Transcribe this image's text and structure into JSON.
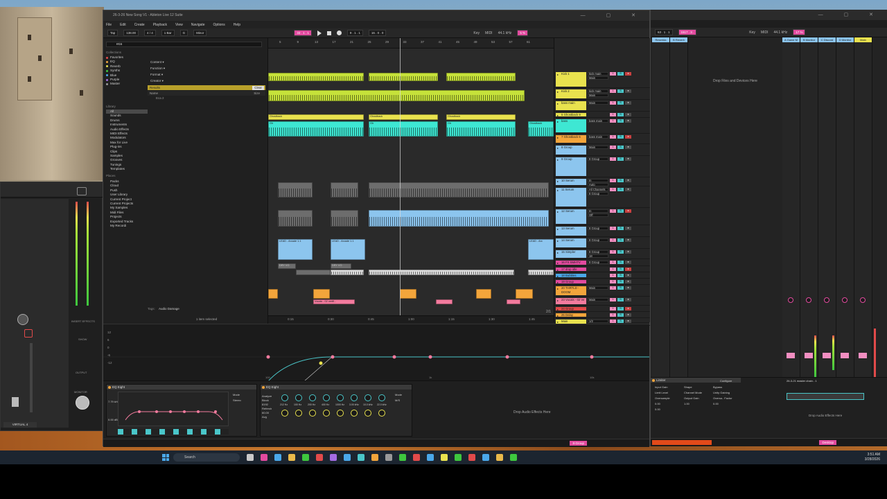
{
  "window": {
    "title": "26-3-26 New Song V1 - Ableton Live 12 Suite",
    "menu": [
      "File",
      "Edit",
      "Create",
      "Playback",
      "View",
      "Navigate",
      "Options",
      "Help"
    ]
  },
  "transport": {
    "tap": "Tap",
    "tempo": "138.00",
    "time_sig": "4 / 4",
    "quantize": "1 Bar",
    "key": "G",
    "scale": "Minor",
    "position": "33 . 1 . 1",
    "loop_start": "9 . 1 . 1",
    "loop_len": "16 . 0 . 0",
    "key_label": "Key",
    "midi_label": "MIDI",
    "sample_rate": "44.1 kHz",
    "cpu": "5 %"
  },
  "browser": {
    "search_value": "eca",
    "collections_title": "Collections",
    "collections": [
      {
        "label": "Favorites",
        "color": "#e24a4a"
      },
      {
        "label": "EQ",
        "color": "#f3a53b"
      },
      {
        "label": "Reverb",
        "color": "#e9e24e"
      },
      {
        "label": "Synths",
        "color": "#3ec73e"
      },
      {
        "label": "Blue",
        "color": "#4aa8ea"
      },
      {
        "label": "Purple",
        "color": "#a36be2"
      },
      {
        "label": "Master",
        "color": "#999999"
      }
    ],
    "library_title": "Library",
    "library": [
      "All",
      "Sounds",
      "Drums",
      "Instruments",
      "Audio Effects",
      "MIDI Effects",
      "Modulators",
      "Max for Live",
      "Plug-ins",
      "Clips",
      "Samples",
      "Grooves",
      "Tunings",
      "Templates"
    ],
    "places_title": "Places",
    "places": [
      "Packs",
      "Cloud",
      "Push",
      "User Library",
      "Current Project",
      "Current Projects",
      "My Samples",
      "Midi Files",
      "Projects",
      "Exported Tracks",
      "My Recordi"
    ],
    "filters": [
      "Content ▾",
      "Function ▾",
      "Format ▾",
      "Creator ▾"
    ],
    "results_label": "Results",
    "clear_label": "Clear",
    "name_col": "Name",
    "size_col": "Size",
    "result_item": "Eca 2",
    "tags_label": "Tags:",
    "tags_value": "Audio Damage",
    "footer": "1 item selected"
  },
  "arrangement": {
    "ruler": [
      "5",
      "9",
      "13",
      "17",
      "21",
      "25",
      "29",
      "33",
      "37",
      "41",
      "45",
      "49",
      "53",
      "57",
      "61"
    ],
    "timebar": [
      "0:15",
      "0:30",
      "0:45",
      "1:00",
      "1:15",
      "1:30",
      "1:45"
    ],
    "clip_ghost": "Gh",
    "clip_ghostback": "Ghostback",
    "clip_lead": "LEAD - Arcade 1.1",
    "clip_lead_short": "LEAD - Arc",
    "clip_dry": "DRY VO",
    "clip_vox": "Vocals - 02 vertfl...",
    "page_indicator": "2/1"
  },
  "tracks": [
    {
      "name": "Kick 1",
      "color": "#e9e24e",
      "route": [
        "kick main",
        "Main"
      ],
      "h": 24
    },
    {
      "name": "Kick 2",
      "color": "#e9e24e",
      "route": [
        "kick main",
        "Main"
      ],
      "h": 16
    },
    {
      "name": "bass main",
      "color": "#e9e24e",
      "route": [
        "Main",
        ""
      ],
      "h": 16
    },
    {
      "name": "5 Ghostback 9",
      "color": "#e9e24e",
      "route": [
        "",
        ""
      ],
      "h": 8
    },
    {
      "name": "bass",
      "color": "#3ee7d3",
      "route": [
        "bass main",
        ""
      ],
      "h": 22
    },
    {
      "name": "7 Ghostback 6",
      "color": "#f3a53b",
      "route": [
        "bass main",
        ""
      ],
      "h": 14
    },
    {
      "name": "8 Group",
      "color": "#8cc5ee",
      "route": [
        "Main",
        ""
      ],
      "h": 16
    },
    {
      "name": "9 Group",
      "color": "#8cc5ee",
      "route": [
        "8 Group",
        ""
      ],
      "h": 30
    },
    {
      "name": "10 Serum",
      "color": "#8cc5ee",
      "route": [
        "In",
        "Auto"
      ],
      "h": 12
    },
    {
      "name": "11 Serum",
      "color": "#8cc5ee",
      "route": [
        "All Channels",
        "8 Group"
      ],
      "h": 30
    },
    {
      "name": "12 Serum",
      "color": "#8cc5ee",
      "route": [
        "In",
        "Off"
      ],
      "h": 24
    },
    {
      "name": "13 Serum",
      "color": "#8cc5ee",
      "route": [
        "8 Group",
        ""
      ],
      "h": 16
    },
    {
      "name": "14 Serum",
      "color": "#8cc5ee",
      "route": [
        "8 Group",
        ""
      ],
      "h": 16
    },
    {
      "name": "15 Simpler",
      "color": "#8cc5ee",
      "route": [
        "8 Group",
        "18"
      ],
      "h": 14
    },
    {
      "name": "16 FX SMHTV",
      "color": "#e24a9e",
      "route": [
        "8 Group",
        ""
      ],
      "h": 9
    },
    {
      "name": "17 drop idle",
      "color": "#e24a9e",
      "route": [
        "",
        ""
      ],
      "h": 8
    },
    {
      "name": "18 Bubbles",
      "color": "#4aa8ea",
      "route": [
        "",
        ""
      ],
      "h": 8
    },
    {
      "name": "19 Group",
      "color": "#e24a9e",
      "route": [
        "",
        ""
      ],
      "h": 8
    },
    {
      "name": "20 THRTLD - DOOM",
      "color": "#f3a53b",
      "route": [
        "Main",
        ""
      ],
      "h": 16
    },
    {
      "name": "23 Vocals - 02 Ve",
      "color": "#f37b9e",
      "route": [
        "Main",
        ""
      ],
      "h": 12
    },
    {
      "name": "24 Group",
      "color": "#e24a4a",
      "route": [
        "",
        ""
      ],
      "h": 8
    },
    {
      "name": "25 Delay",
      "color": "#f3a53b",
      "route": [
        "",
        ""
      ],
      "h": 8
    },
    {
      "name": "Main",
      "color": "#e9e24e",
      "route": [
        "1/2",
        ""
      ],
      "h": 10
    }
  ],
  "devices": {
    "eq1_title": "EQ Eight",
    "eq2_title": "EQ Eight",
    "eq1_freq": "7.79 kHz",
    "eq1_gain": "0.00 dB",
    "eq1_mode": "Mode",
    "eq1_stereo": "Stereo",
    "eq2_analyze": "Analyze",
    "eq2_block": "Block",
    "eq2_block_val": "8192",
    "eq2_refresh": "Refresh",
    "eq2_refresh_val": "60.00",
    "eq2_avg": "Avg",
    "eq2_mode": "Mode",
    "eq2_mode_val": "M/S",
    "eq2_freqs": [
      "212 Hz",
      "100 Hz",
      "200 Hz",
      "400 Hz",
      "1000 Hz",
      "3.00 kHz",
      "10.0 kHz",
      "22.0 kHz"
    ],
    "drop_label": "Drop Audio Effects Here",
    "status_group": "8-Group"
  },
  "automation": {
    "axis": [
      "12",
      "6",
      "0",
      "-6",
      "-12"
    ],
    "freq_ticks": [
      "100",
      "1k",
      "10k"
    ]
  },
  "second_window": {
    "tempo": "63 . 1 . 1",
    "pos": "1517 . 3 .",
    "key_label": "Key",
    "midi_label": "MIDI",
    "sample_rate": "44.1 kHz",
    "cpu": "17 %",
    "track_tabs": [
      "Reserida",
      "B Reverb"
    ],
    "drop_files": "Drop Files and Devices Here",
    "right_tabs": [
      "A Game M",
      "B Monitor",
      "C Discord",
      "D Monitor",
      "Main"
    ],
    "limiter_title": "Limiter",
    "limiter_params": [
      "Input Gain",
      "Shape",
      "Bypass",
      "Limit Level",
      "Channel Mode",
      "Unity Gaining",
      "Oversample",
      "Output Gain",
      "Oversa.. Factor"
    ],
    "limiter_vals": [
      "0.00",
      "1.00",
      "0.00",
      "0.00"
    ],
    "utility_label": "Configure",
    "chain_title": "26-3-21 master chain - 1",
    "drop_label": "Drop Audio Effects Here",
    "status_label": "Desktop"
  },
  "plugin": {
    "title": "VIRTUAL 4",
    "sections": [
      "INSERT EFFECTS",
      "SHOW",
      "OUTPUT",
      "MONITOR"
    ]
  },
  "taskbar": {
    "search_placeholder": "Search",
    "time": "3:51 AM",
    "date": "3/28/2026"
  }
}
